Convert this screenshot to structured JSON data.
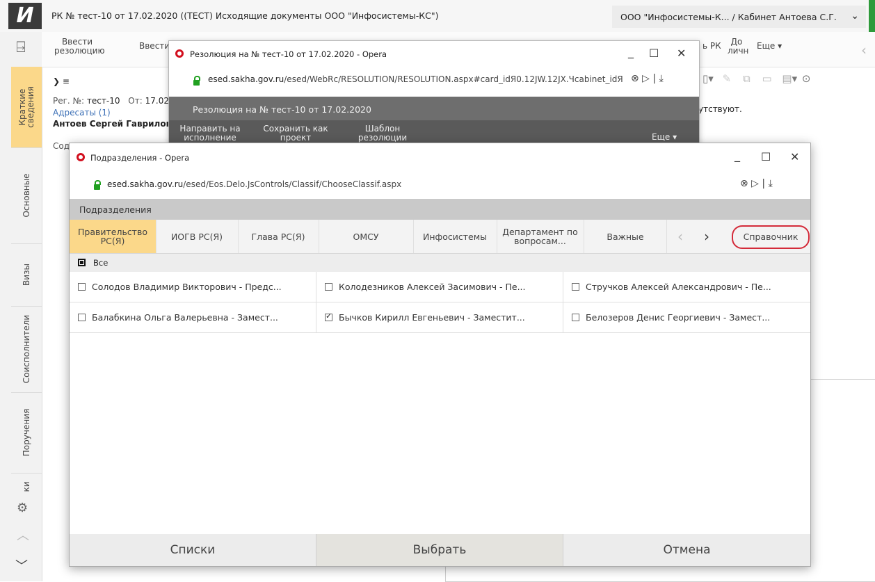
{
  "app": {
    "logo_letter": "И",
    "title": "РК № тест-10 от 17.02.2020 ((ТЕСТ) Исходящие документы ООО \"Инфосистемы-КС\")",
    "org_cabinet": "ООО \"Инфосистемы-К... / Кабинет Антоева С.Г.",
    "chevron": "⌄"
  },
  "leftnav": {
    "tabs": [
      "Краткие сведения",
      "Основные",
      "Визы",
      "Соисполнители",
      "Поручения",
      "ки"
    ]
  },
  "toolbar": {
    "enter_resolution": "Ввести резолюцию",
    "enter": "Ввести",
    "rk_fragment": "ь РК",
    "personal_fragment": "До личн",
    "more": "Еще"
  },
  "doc": {
    "expander": "❯ ≡",
    "reg_label": "Рег. №:",
    "reg_value": "тест-10",
    "from_label": "От:",
    "from_value": "17.02.",
    "addressees": "Адресаты (1)",
    "person": "Антоев Сергей Гаврилов",
    "content_fragment": "Сод",
    "absent_fragment": "утствуют."
  },
  "res_window": {
    "title": "Резолюция на № тест-10 от 17.02.2020 - Opera",
    "url_host": "esed.sakha.gov.ru",
    "url_path": "/esed/WebRc/RESOLUTION/RESOLUTION.aspx#card_idЯ0.12JW.12JX.Чcabinet_idЯ",
    "header": "Резолюция на № тест-10 от 17.02.2020",
    "btn_send": "Направить на исполнение",
    "btn_save": "Сохранить как проект",
    "btn_template": "Шаблон резолюции",
    "btn_more": "Еще"
  },
  "sub_window": {
    "title": "Подразделения - Opera",
    "url_host": "esed.sakha.gov.ru",
    "url_path": "/esed/Eos.Delo.JsControls/Classif/ChooseClassif.aspx",
    "header": "Подразделения",
    "tabs": [
      {
        "label": "Правительство РС(Я)",
        "active": true
      },
      {
        "label": "ИОГВ РС(Я)",
        "active": false
      },
      {
        "label": "Глава РС(Я)",
        "active": false
      },
      {
        "label": "ОМСУ",
        "active": false
      },
      {
        "label": "Инфосистемы",
        "active": false
      },
      {
        "label": "Департамент по вопросам...",
        "active": false
      },
      {
        "label": "Важные",
        "active": false
      }
    ],
    "directory": "Справочник",
    "all_label": "Все",
    "people": [
      {
        "name": "Солодов Владимир Викторович - Предс...",
        "checked": false
      },
      {
        "name": "Колодезников Алексей Засимович - Пе...",
        "checked": false
      },
      {
        "name": "Стручков Алексей Александрович - Пе...",
        "checked": false
      },
      {
        "name": "Балабкина Ольга Валерьевна - Замест...",
        "checked": false
      },
      {
        "name": "Бычков Кирилл Евгеньевич - Заместит...",
        "checked": true
      },
      {
        "name": "Белозеров Денис Георгиевич - Замест...",
        "checked": false
      }
    ],
    "footer": {
      "lists": "Списки",
      "select": "Выбрать",
      "cancel": "Отмена"
    }
  },
  "colors": {
    "active_tab": "#fbd88a",
    "highlight_ring": "#d42b3a",
    "opera_red": "#d20f1e"
  }
}
